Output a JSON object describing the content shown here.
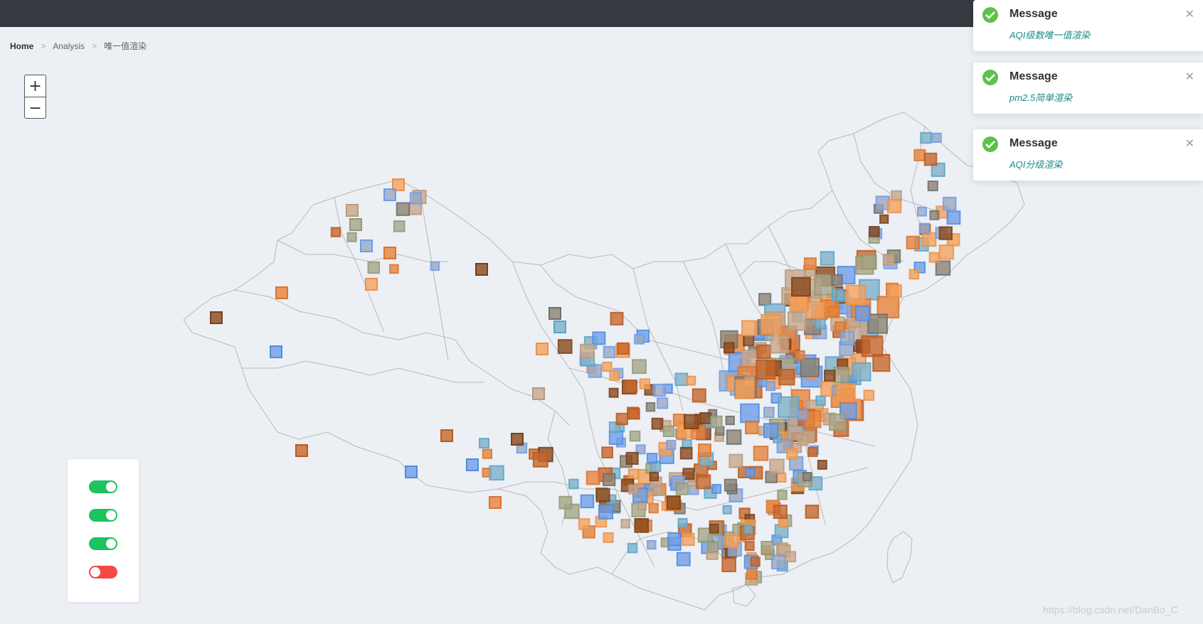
{
  "breadcrumb": {
    "home": "Home",
    "analysis": "Analysis",
    "current": "唯一值渲染"
  },
  "zoom": {
    "in_label": "+",
    "out_label": "−"
  },
  "notifications": [
    {
      "title": "Message",
      "message": "AQI级数唯一值渲染"
    },
    {
      "title": "Message",
      "message": "pm2.5简单渲染"
    },
    {
      "title": "Message",
      "message": "AQI分级渲染"
    }
  ],
  "close_glyph": "✕",
  "layers": [
    {
      "state": "on",
      "color": "#1ec25f"
    },
    {
      "state": "on",
      "color": "#1ec25f"
    },
    {
      "state": "on",
      "color": "#1ec25f"
    },
    {
      "state": "off",
      "color": "#f54848"
    }
  ],
  "colors": {
    "topbar": "#343a40",
    "success": "#5ec14a",
    "message_text": "#1c8a8a",
    "boundary": "#b8b8b8"
  },
  "watermark": "https://blog.csdn.net/DanBo_C"
}
